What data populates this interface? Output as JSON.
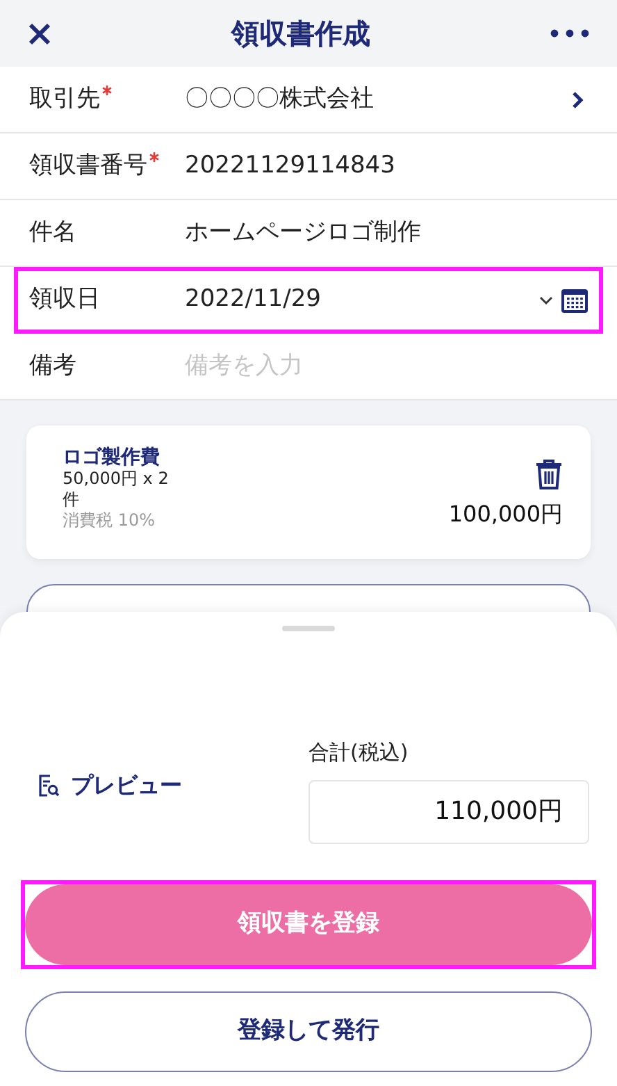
{
  "header": {
    "title": "領収書作成"
  },
  "fields": [
    {
      "kind": "link",
      "label": "取引先",
      "required": true,
      "value": "〇〇〇〇株式会社",
      "highlighted": false
    },
    {
      "kind": "text",
      "label": "領収書番号",
      "required": true,
      "value": "20221129114843",
      "highlighted": false
    },
    {
      "kind": "text",
      "label": "件名",
      "required": false,
      "value": "ホームページロゴ制作",
      "highlighted": false
    },
    {
      "kind": "date",
      "label": "領収日",
      "required": false,
      "value": "2022/11/29",
      "highlighted": true
    },
    {
      "kind": "input",
      "label": "備考",
      "required": false,
      "placeholder": "備考を入力",
      "highlighted": false
    }
  ],
  "items": [
    {
      "name": "ロゴ製作費",
      "price": "50,000円 x 2",
      "unit": "件",
      "tax": "消費税 10%",
      "amount": "100,000円"
    }
  ],
  "summary": {
    "preview": "プレビュー",
    "total_label": "合計(税込)",
    "total": "110,000円"
  },
  "actions": [
    {
      "kind": "primary",
      "label": "領収書を登録",
      "highlighted": true
    },
    {
      "kind": "outline",
      "label": "登録して発行",
      "highlighted": false
    }
  ]
}
